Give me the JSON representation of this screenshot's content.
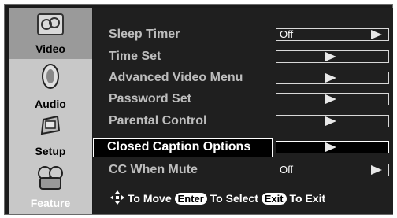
{
  "sidebar": {
    "items": [
      {
        "label": "Video",
        "icon": "video-icon",
        "active": true
      },
      {
        "label": "Audio",
        "icon": "speaker-icon",
        "active": false
      },
      {
        "label": "Setup",
        "icon": "gear-icon",
        "active": false
      },
      {
        "label": "Feature",
        "icon": "tools-icon",
        "active": false
      }
    ]
  },
  "menu": {
    "rows": [
      {
        "label": "Sleep Timer",
        "value": "Off"
      },
      {
        "label": "Time Set",
        "value": ""
      },
      {
        "label": "Advanced Video Menu",
        "value": ""
      },
      {
        "label": "Password Set",
        "value": ""
      },
      {
        "label": "Parental Control",
        "value": ""
      },
      {
        "label": "Closed Caption Options",
        "value": "",
        "selected": true
      },
      {
        "label": "CC When Mute",
        "value": "Off"
      }
    ]
  },
  "footer": {
    "move": "To Move",
    "enter_key": "Enter",
    "select": "To Select",
    "exit_key": "Exit",
    "exit": "To Exit"
  },
  "colors": {
    "panel_bg": "#1f1f1f",
    "sidebar_bg": "#c8c8c8",
    "selected_border": "#ffffff"
  }
}
